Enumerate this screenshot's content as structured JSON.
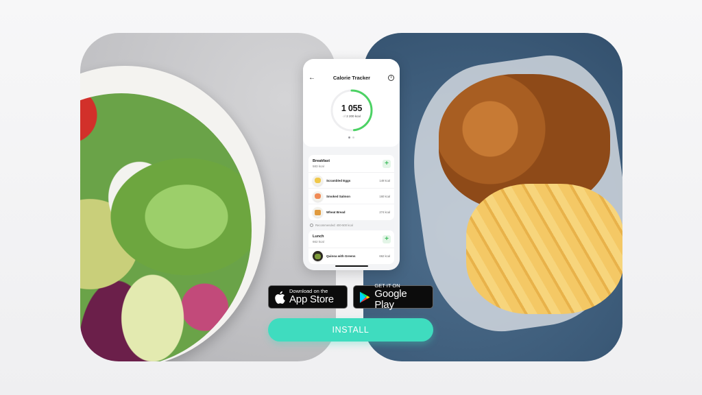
{
  "colors": {
    "accent": "#3fdcbf",
    "progress_green": "#4cd264",
    "background": "#f2f2f4"
  },
  "images": {
    "left": "salad-bowl-photo",
    "right": "fried-chicken-and-fries-photo"
  },
  "phone": {
    "header": {
      "back_icon": "arrow-left-icon",
      "title": "Calorie Tracker",
      "info_icon": "info-icon"
    },
    "summary": {
      "consumed": "1 055",
      "goal_label": "of",
      "goal": "2 200 kcal",
      "progress_fraction": 0.48,
      "page_dots": 2,
      "active_dot": 0
    },
    "meals": [
      {
        "name": "Breakfast",
        "kcal": "583 kcal",
        "items": [
          {
            "name": "Scrambled Eggs",
            "kcal": "149 kcal",
            "icon": "scrambled-eggs-icon"
          },
          {
            "name": "Smoked Salmon",
            "kcal": "160 kcal",
            "icon": "smoked-salmon-icon"
          },
          {
            "name": "Wheat Bread",
            "kcal": "274 kcal",
            "icon": "wheat-bread-icon"
          }
        ],
        "recommendation": "Recommended: 400-500 kcal"
      },
      {
        "name": "Lunch",
        "kcal": "662 kcal",
        "items": [
          {
            "name": "Quinoa with Greens",
            "kcal": "662 kcal",
            "icon": "quinoa-bowl-icon"
          }
        ]
      }
    ]
  },
  "stores": {
    "apple": {
      "small": "Download on the",
      "big": "App Store"
    },
    "google": {
      "small": "GET IT ON",
      "big": "Google Play"
    }
  },
  "cta": {
    "label": "INSTALL"
  }
}
